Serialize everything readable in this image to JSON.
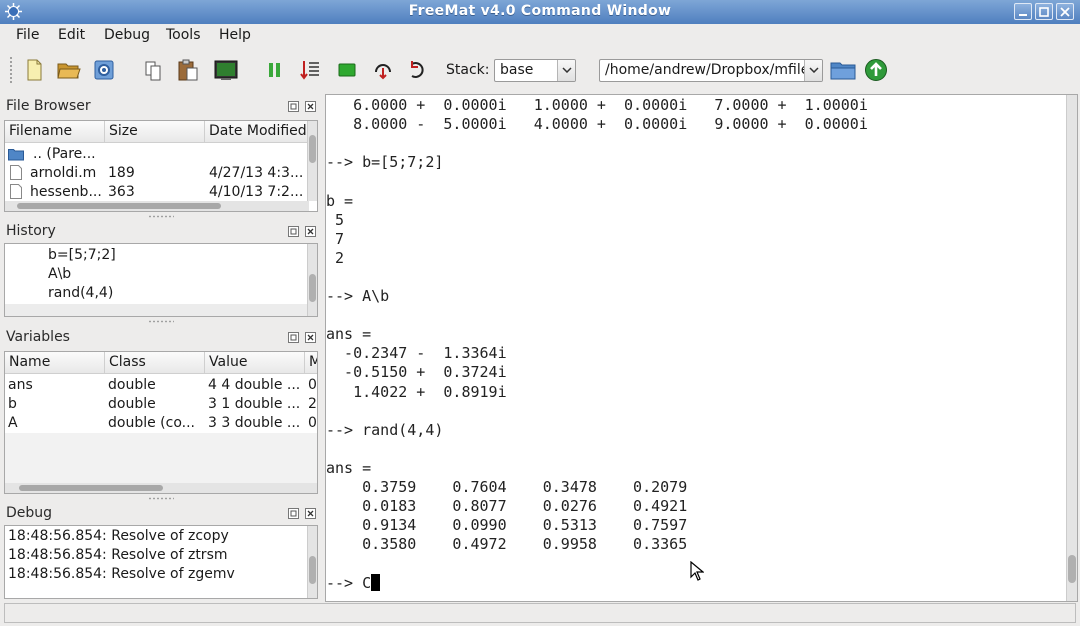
{
  "window": {
    "title": "FreeMat v4.0 Command Window"
  },
  "menu": [
    "File",
    "Edit",
    "Debug",
    "Tools",
    "Help"
  ],
  "toolbar": {
    "stack_label": "Stack:",
    "stack_value": "base",
    "path_value": "/home/andrew/Dropbox/mfiles"
  },
  "file_browser": {
    "title": "File Browser",
    "columns": [
      "Filename",
      "Size",
      "Date Modified"
    ],
    "rows": [
      {
        "name": ".. (Pare...",
        "size": "",
        "date": "",
        "icon": "folder-icon"
      },
      {
        "name": "arnoldi.m",
        "size": "189",
        "date": "4/27/13 4:3...",
        "icon": "file-icon"
      },
      {
        "name": "hessenb...",
        "size": "363",
        "date": "4/10/13 7:2...",
        "icon": "file-icon"
      }
    ]
  },
  "history": {
    "title": "History",
    "items": [
      "b=[5;7;2]",
      "A\\b",
      "rand(4,4)"
    ]
  },
  "variables": {
    "title": "Variables",
    "columns": [
      "Name",
      "Class",
      "Value",
      "M"
    ],
    "rows": [
      {
        "name": "ans",
        "class": "double",
        "value": "4 4 double ...",
        "m": "0"
      },
      {
        "name": "b",
        "class": "double",
        "value": "3 1 double ...",
        "m": "2"
      },
      {
        "name": "A",
        "class": "double (co...",
        "value": "3 3 double ...",
        "m": "0"
      }
    ]
  },
  "debug": {
    "title": "Debug",
    "lines": [
      "18:48:56.854: Resolve of zcopy",
      "18:48:56.854: Resolve of ztrsm",
      "18:48:56.854: Resolve of zgemv"
    ]
  },
  "console": {
    "lines": [
      "   6.0000 +  0.0000i   1.0000 +  0.0000i   7.0000 +  1.0000i",
      "   8.0000 -  5.0000i   4.0000 +  0.0000i   9.0000 +  0.0000i",
      "",
      "--> b=[5;7;2]",
      "",
      "b =",
      " 5",
      " 7",
      " 2",
      "",
      "--> A\\b",
      "",
      "ans =",
      "  -0.2347 -  1.3364i",
      "  -0.5150 +  0.3724i",
      "   1.4022 +  0.8919i",
      "",
      "--> rand(4,4)",
      "",
      "ans =",
      "    0.3759    0.7604    0.3478    0.2079",
      "    0.0183    0.8077    0.0276    0.4921",
      "    0.9134    0.0990    0.5313    0.7597",
      "    0.3580    0.4972    0.9958    0.3365",
      "",
      "--> C"
    ]
  }
}
